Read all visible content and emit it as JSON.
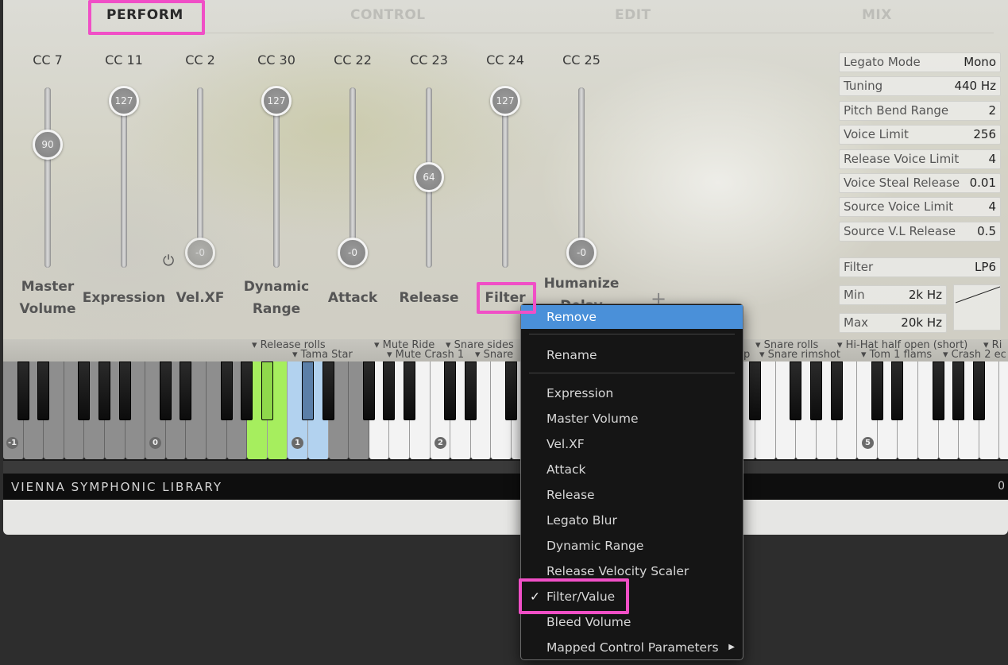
{
  "tabs": [
    {
      "label": "PERFORM",
      "active": true
    },
    {
      "label": "CONTROL",
      "active": false
    },
    {
      "label": "EDIT",
      "active": false
    },
    {
      "label": "MIX",
      "active": false
    }
  ],
  "faders": [
    {
      "cc": "CC 7",
      "value": "90",
      "name": "Master Volume",
      "name_lines": [
        "Master",
        "Volume"
      ],
      "level": 0.71
    },
    {
      "cc": "CC 11",
      "value": "127",
      "name": "Expression",
      "name_lines": [
        "Expression"
      ],
      "level": 1.0
    },
    {
      "cc": "CC 2",
      "value": "-0",
      "name": "Vel.XF",
      "name_lines": [
        "Vel.XF"
      ],
      "level": 0.0,
      "dim": true
    },
    {
      "cc": "CC 30",
      "value": "127",
      "name": "Dynamic Range",
      "name_lines": [
        "Dynamic",
        "Range"
      ],
      "level": 1.0
    },
    {
      "cc": "CC 22",
      "value": "-0",
      "name": "Attack",
      "name_lines": [
        "Attack"
      ],
      "level": 0.0
    },
    {
      "cc": "CC 23",
      "value": "64",
      "name": "Release",
      "name_lines": [
        "Release"
      ],
      "level": 0.5
    },
    {
      "cc": "CC 24",
      "value": "127",
      "name": "Filter",
      "name_lines": [
        "Filter"
      ],
      "level": 1.0
    },
    {
      "cc": "CC 25",
      "value": "-0",
      "name": "Humanize Delay",
      "name_lines": [
        "Humanize",
        "Delay"
      ],
      "level": 0.0
    }
  ],
  "add_label": "+",
  "params": [
    {
      "label": "Legato Mode",
      "value": "Mono"
    },
    {
      "label": "Tuning",
      "value": "440 Hz"
    },
    {
      "label": "Pitch Bend Range",
      "value": "2"
    },
    {
      "label": "Voice Limit",
      "value": "256"
    },
    {
      "label": "Release Voice Limit",
      "value": "4"
    },
    {
      "label": "Voice Steal Release",
      "value": "0.01"
    },
    {
      "label": "Source Voice Limit",
      "value": "4"
    },
    {
      "label": "Source V.L Release",
      "value": "0.5"
    }
  ],
  "filter": {
    "label": "Filter",
    "value": "LP6",
    "min_label": "Min",
    "min_value": "2k Hz",
    "max_label": "Max",
    "max_value": "20k Hz"
  },
  "key_labels_top": [
    "▾ Release rolls",
    "▾ Mute Ride",
    "▾ Snare sides",
    "▾ Snare rolls",
    "▾ Hi-Hat half open (short)",
    "▾ Ri"
  ],
  "key_labels_bottom": [
    "▾ Tama Star",
    "▾ Mute Crash 1",
    "▾ Snare",
    "▾ Snare rimshot",
    "▾ Tom 1 flams",
    "▾ Crash 2 ec"
  ],
  "partial_label_p": "p",
  "octaves": [
    "-1",
    "0",
    "1",
    "2",
    "5"
  ],
  "brand": "VIENNA SYMPHONIC LIBRARY",
  "footer_value": "0",
  "menu": {
    "top": [
      "Remove",
      "Rename"
    ],
    "items": [
      "Expression",
      "Master Volume",
      "Vel.XF",
      "Attack",
      "Release",
      "Legato Blur",
      "Dynamic Range",
      "Release Velocity Scaler",
      "Filter/Value",
      "Bleed Volume",
      "Mapped Control Parameters"
    ],
    "checked": "Filter/Value",
    "check_glyph": "✓",
    "submenu_glyph": "▶"
  },
  "colors": {
    "highlight": "#f04fc6",
    "menu_active": "#4a90d9",
    "key_green": "#a6ee5e",
    "key_blue": "#b2d2ef"
  }
}
